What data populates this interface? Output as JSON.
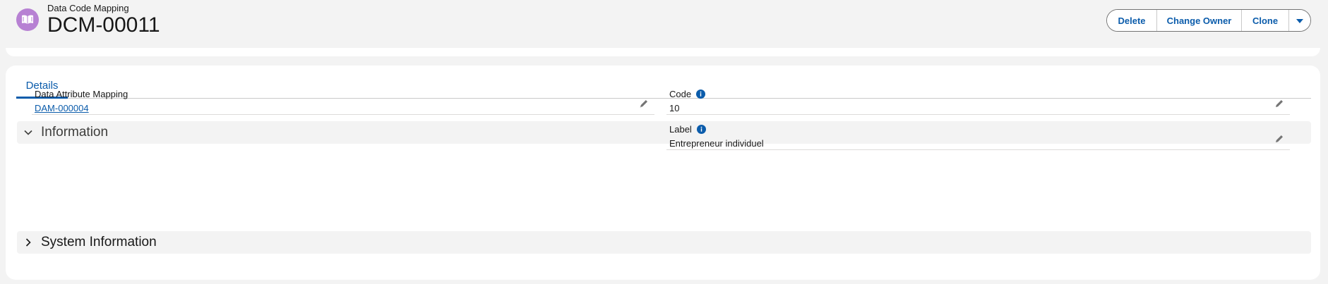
{
  "header": {
    "object_type": "Data Code Mapping",
    "record_name": "DCM-00011",
    "object_icon": "book-icon",
    "object_icon_color": "#b781d3"
  },
  "actions": {
    "delete": "Delete",
    "change_owner": "Change Owner",
    "clone": "Clone",
    "more_icon": "chevron-down-icon"
  },
  "tabs": [
    {
      "label": "Details",
      "active": true
    }
  ],
  "sections": {
    "information": {
      "title": "Information",
      "expanded": true
    },
    "system_information": {
      "title": "System Information",
      "expanded": false
    }
  },
  "fields": {
    "data_attribute_mapping": {
      "label": "Data Attribute Mapping",
      "value": "DAM-000004"
    },
    "code": {
      "label": "Code",
      "value": "10"
    },
    "label": {
      "label": "Label",
      "value": "Entrepreneur individuel"
    }
  },
  "colors": {
    "brand_blue": "#0b5cab",
    "page_bg": "#f3f3f3",
    "card_bg": "#ffffff"
  }
}
